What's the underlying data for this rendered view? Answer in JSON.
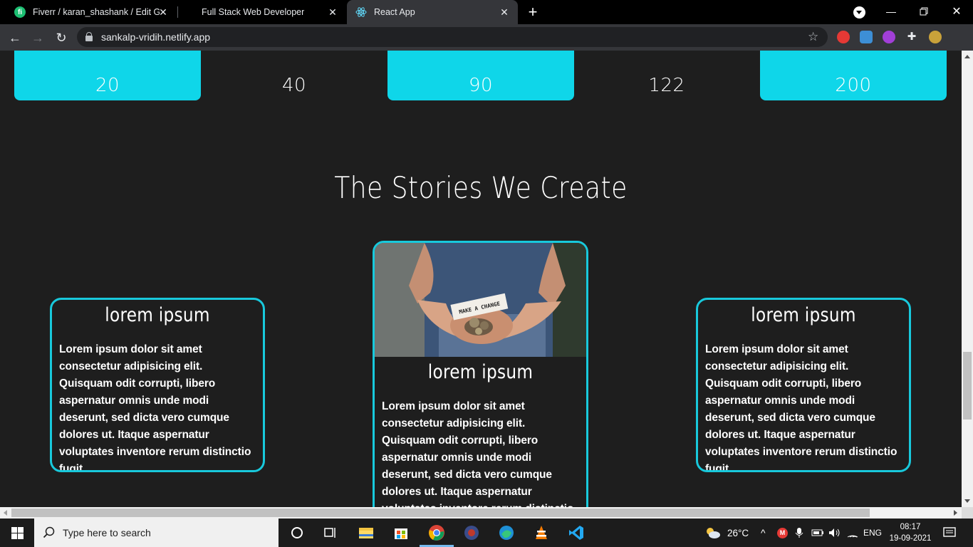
{
  "browser": {
    "tabs": [
      {
        "title": "Fiverr / karan_shashank / Edit Gig",
        "favicon": "fiverr-icon",
        "active": false
      },
      {
        "title": "Full Stack Web Developer",
        "favicon": "none",
        "active": false
      },
      {
        "title": "React App",
        "favicon": "react-icon",
        "active": true
      }
    ],
    "url": "sankalp-vridih.netlify.app"
  },
  "page": {
    "stats": [
      "20",
      "40",
      "90",
      "122",
      "200"
    ],
    "section_title": "The Stories We Create",
    "cards": [
      {
        "title": "lorem ipsum",
        "text": "Lorem ipsum dolor sit amet consectetur adipisicing elit. Quisquam odit corrupti, libero aspernatur omnis unde modi deserunt, sed dicta vero cumque dolores ut. Itaque aspernatur voluptates inventore rerum distinctio fugit."
      },
      {
        "title": "lorem ipsum",
        "text": "Lorem ipsum dolor sit amet consectetur adipisicing elit. Quisquam odit corrupti, libero aspernatur omnis unde modi deserunt, sed dicta vero cumque dolores ut. Itaque aspernatur voluptates inventore rerum distinctio fugit.",
        "image_text": "MAKE A CHANGE"
      },
      {
        "title": "lorem ipsum",
        "text": "Lorem ipsum dolor sit amet consectetur adipisicing elit. Quisquam odit corrupti, libero aspernatur omnis unde modi deserunt, sed dicta vero cumque dolores ut. Itaque aspernatur voluptates inventore rerum distinctio fugit."
      }
    ],
    "accent_color": "#0fd6e9"
  },
  "taskbar": {
    "search_placeholder": "Type here to search",
    "weather": "26°C",
    "language": "ENG",
    "time": "08:17",
    "date": "19-09-2021"
  }
}
